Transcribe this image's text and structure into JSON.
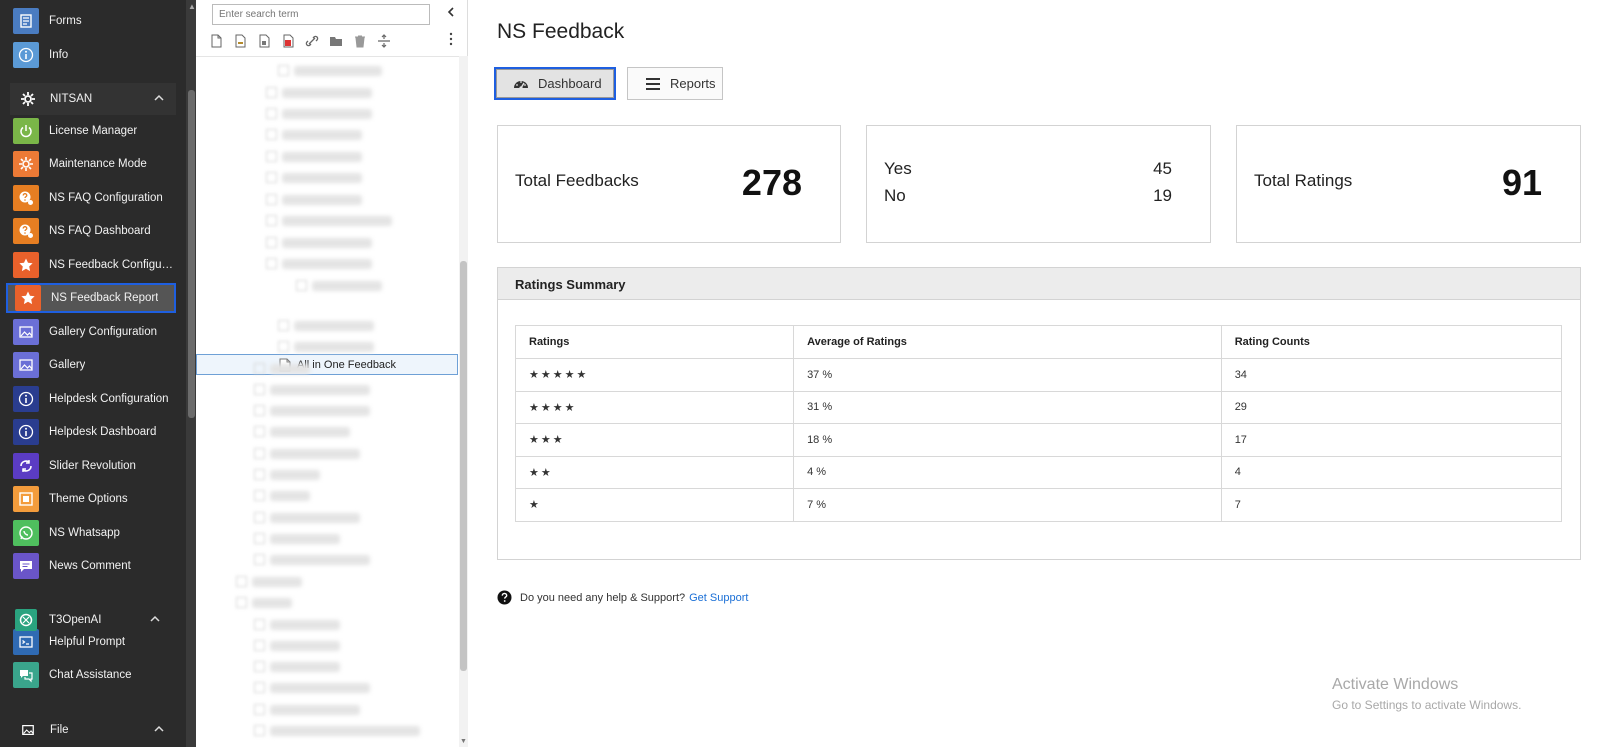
{
  "sidebar": {
    "items": [
      {
        "label": "Forms",
        "icon": "forms-icon",
        "color": "#4a7cc1"
      },
      {
        "label": "Info",
        "icon": "info-icon",
        "color": "#5b9ad6"
      },
      {
        "label": "License Manager",
        "icon": "power-icon",
        "color": "#7ab648"
      },
      {
        "label": "Maintenance Mode",
        "icon": "gear-icon",
        "color": "#ec7a36"
      },
      {
        "label": "NS FAQ Configuration",
        "icon": "faq-icon",
        "color": "#e67e22"
      },
      {
        "label": "NS FAQ Dashboard",
        "icon": "faq-icon",
        "color": "#e67e22"
      },
      {
        "label": "NS Feedback Configur...",
        "icon": "star-icon",
        "color": "#e9612b"
      },
      {
        "label": "NS Feedback Report",
        "icon": "star-icon",
        "color": "#e9612b"
      },
      {
        "label": "Gallery Configuration",
        "icon": "image-icon",
        "color": "#6b6fd6"
      },
      {
        "label": "Gallery",
        "icon": "image-icon",
        "color": "#6b6fd6"
      },
      {
        "label": "Helpdesk Configuration",
        "icon": "info-icon",
        "color": "#2a3d8f"
      },
      {
        "label": "Helpdesk Dashboard",
        "icon": "info-icon",
        "color": "#2a3d8f"
      },
      {
        "label": "Slider Revolution",
        "icon": "refresh-icon",
        "color": "#5b3cc4"
      },
      {
        "label": "Theme Options",
        "icon": "box-icon",
        "color": "#f39c3c"
      },
      {
        "label": "NS Whatsapp",
        "icon": "whatsapp-icon",
        "color": "#4fbf5e"
      },
      {
        "label": "News Comment",
        "icon": "comment-icon",
        "color": "#6a55c9"
      },
      {
        "label": "Helpful Prompt",
        "icon": "terminal-icon",
        "color": "#2f6ab3"
      },
      {
        "label": "Chat Assistance",
        "icon": "chat-icon",
        "color": "#3aa58c"
      }
    ],
    "groups": {
      "nitsan": "NITSAN",
      "t3openai": "T3OpenAI",
      "file": "File"
    }
  },
  "tree": {
    "search_placeholder": "Enter search term",
    "selected_page": "All in One Feedback"
  },
  "main": {
    "title": "NS Feedback",
    "tabs": {
      "dashboard": "Dashboard",
      "reports": "Reports"
    },
    "cards": {
      "total_feedbacks_label": "Total Feedbacks",
      "total_feedbacks_value": "278",
      "yes_label": "Yes",
      "yes_value": "45",
      "no_label": "No",
      "no_value": "19",
      "total_ratings_label": "Total Ratings",
      "total_ratings_value": "91"
    },
    "summary": {
      "title": "Ratings Summary",
      "columns": [
        "Ratings",
        "Average of Ratings",
        "Rating Counts"
      ],
      "rows": [
        {
          "stars": "★★★★★",
          "avg": "37 %",
          "count": "34"
        },
        {
          "stars": "★★★★",
          "avg": "31 %",
          "count": "29"
        },
        {
          "stars": "★★★",
          "avg": "18 %",
          "count": "17"
        },
        {
          "stars": "★★",
          "avg": "4 %",
          "count": "4"
        },
        {
          "stars": "★",
          "avg": "7 %",
          "count": "7"
        }
      ]
    },
    "help": {
      "text": "Do you need any help & Support?",
      "link": "Get Support"
    },
    "watermark": {
      "line1": "Activate Windows",
      "line2": "Go to Settings to activate Windows."
    }
  }
}
